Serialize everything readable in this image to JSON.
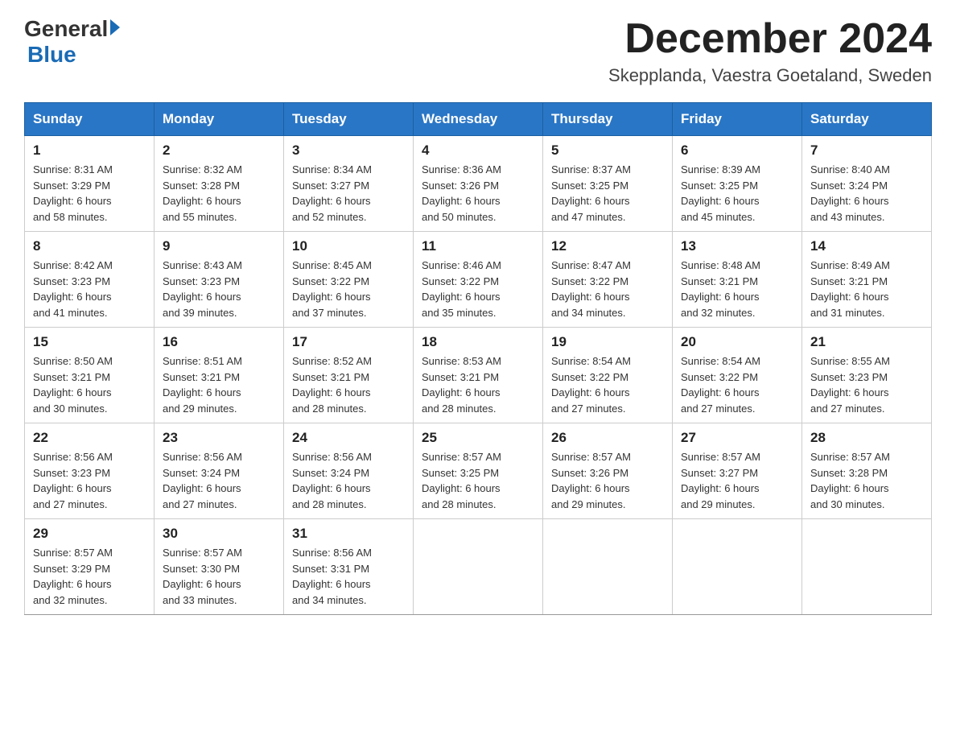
{
  "logo": {
    "general": "General",
    "blue": "Blue"
  },
  "title": "December 2024",
  "location": "Skepplanda, Vaestra Goetaland, Sweden",
  "columns": [
    "Sunday",
    "Monday",
    "Tuesday",
    "Wednesday",
    "Thursday",
    "Friday",
    "Saturday"
  ],
  "weeks": [
    [
      {
        "day": "1",
        "sunrise": "8:31 AM",
        "sunset": "3:29 PM",
        "daylight": "6 hours and 58 minutes."
      },
      {
        "day": "2",
        "sunrise": "8:32 AM",
        "sunset": "3:28 PM",
        "daylight": "6 hours and 55 minutes."
      },
      {
        "day": "3",
        "sunrise": "8:34 AM",
        "sunset": "3:27 PM",
        "daylight": "6 hours and 52 minutes."
      },
      {
        "day": "4",
        "sunrise": "8:36 AM",
        "sunset": "3:26 PM",
        "daylight": "6 hours and 50 minutes."
      },
      {
        "day": "5",
        "sunrise": "8:37 AM",
        "sunset": "3:25 PM",
        "daylight": "6 hours and 47 minutes."
      },
      {
        "day": "6",
        "sunrise": "8:39 AM",
        "sunset": "3:25 PM",
        "daylight": "6 hours and 45 minutes."
      },
      {
        "day": "7",
        "sunrise": "8:40 AM",
        "sunset": "3:24 PM",
        "daylight": "6 hours and 43 minutes."
      }
    ],
    [
      {
        "day": "8",
        "sunrise": "8:42 AM",
        "sunset": "3:23 PM",
        "daylight": "6 hours and 41 minutes."
      },
      {
        "day": "9",
        "sunrise": "8:43 AM",
        "sunset": "3:23 PM",
        "daylight": "6 hours and 39 minutes."
      },
      {
        "day": "10",
        "sunrise": "8:45 AM",
        "sunset": "3:22 PM",
        "daylight": "6 hours and 37 minutes."
      },
      {
        "day": "11",
        "sunrise": "8:46 AM",
        "sunset": "3:22 PM",
        "daylight": "6 hours and 35 minutes."
      },
      {
        "day": "12",
        "sunrise": "8:47 AM",
        "sunset": "3:22 PM",
        "daylight": "6 hours and 34 minutes."
      },
      {
        "day": "13",
        "sunrise": "8:48 AM",
        "sunset": "3:21 PM",
        "daylight": "6 hours and 32 minutes."
      },
      {
        "day": "14",
        "sunrise": "8:49 AM",
        "sunset": "3:21 PM",
        "daylight": "6 hours and 31 minutes."
      }
    ],
    [
      {
        "day": "15",
        "sunrise": "8:50 AM",
        "sunset": "3:21 PM",
        "daylight": "6 hours and 30 minutes."
      },
      {
        "day": "16",
        "sunrise": "8:51 AM",
        "sunset": "3:21 PM",
        "daylight": "6 hours and 29 minutes."
      },
      {
        "day": "17",
        "sunrise": "8:52 AM",
        "sunset": "3:21 PM",
        "daylight": "6 hours and 28 minutes."
      },
      {
        "day": "18",
        "sunrise": "8:53 AM",
        "sunset": "3:21 PM",
        "daylight": "6 hours and 28 minutes."
      },
      {
        "day": "19",
        "sunrise": "8:54 AM",
        "sunset": "3:22 PM",
        "daylight": "6 hours and 27 minutes."
      },
      {
        "day": "20",
        "sunrise": "8:54 AM",
        "sunset": "3:22 PM",
        "daylight": "6 hours and 27 minutes."
      },
      {
        "day": "21",
        "sunrise": "8:55 AM",
        "sunset": "3:23 PM",
        "daylight": "6 hours and 27 minutes."
      }
    ],
    [
      {
        "day": "22",
        "sunrise": "8:56 AM",
        "sunset": "3:23 PM",
        "daylight": "6 hours and 27 minutes."
      },
      {
        "day": "23",
        "sunrise": "8:56 AM",
        "sunset": "3:24 PM",
        "daylight": "6 hours and 27 minutes."
      },
      {
        "day": "24",
        "sunrise": "8:56 AM",
        "sunset": "3:24 PM",
        "daylight": "6 hours and 28 minutes."
      },
      {
        "day": "25",
        "sunrise": "8:57 AM",
        "sunset": "3:25 PM",
        "daylight": "6 hours and 28 minutes."
      },
      {
        "day": "26",
        "sunrise": "8:57 AM",
        "sunset": "3:26 PM",
        "daylight": "6 hours and 29 minutes."
      },
      {
        "day": "27",
        "sunrise": "8:57 AM",
        "sunset": "3:27 PM",
        "daylight": "6 hours and 29 minutes."
      },
      {
        "day": "28",
        "sunrise": "8:57 AM",
        "sunset": "3:28 PM",
        "daylight": "6 hours and 30 minutes."
      }
    ],
    [
      {
        "day": "29",
        "sunrise": "8:57 AM",
        "sunset": "3:29 PM",
        "daylight": "6 hours and 32 minutes."
      },
      {
        "day": "30",
        "sunrise": "8:57 AM",
        "sunset": "3:30 PM",
        "daylight": "6 hours and 33 minutes."
      },
      {
        "day": "31",
        "sunrise": "8:56 AM",
        "sunset": "3:31 PM",
        "daylight": "6 hours and 34 minutes."
      },
      null,
      null,
      null,
      null
    ]
  ],
  "labels": {
    "sunrise": "Sunrise: ",
    "sunset": "Sunset: ",
    "daylight": "Daylight: "
  }
}
